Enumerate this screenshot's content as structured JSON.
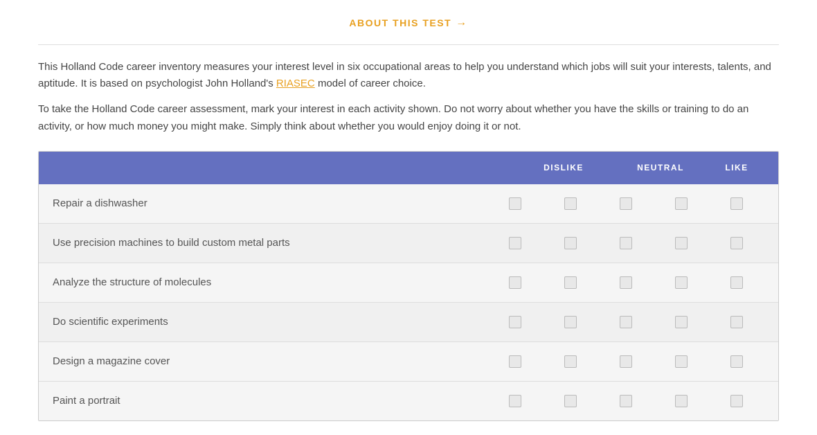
{
  "header": {
    "about_test_label": "ABOUT THIS TEST",
    "arrow": "→"
  },
  "intro": {
    "paragraph1": "This Holland Code career inventory measures your interest level in six occupational areas to help you understand which jobs will suit your interests, talents, and aptitude. It is based on psychologist John Holland's ",
    "riasec_label": "RIASEC",
    "paragraph1_end": " model of career choice.",
    "paragraph2": "To take the Holland Code career assessment, mark your interest in each activity shown. Do not worry about whether you have the skills or training to do an activity, or how much money you might make. Simply think about whether you would enjoy doing it or not."
  },
  "table": {
    "columns": {
      "dislike": "DISLIKE",
      "neutral": "NEUTRAL",
      "like": "LIKE"
    },
    "rows": [
      {
        "id": 1,
        "activity": "Repair a dishwasher"
      },
      {
        "id": 2,
        "activity": "Use precision machines to build custom metal parts"
      },
      {
        "id": 3,
        "activity": "Analyze the structure of molecules"
      },
      {
        "id": 4,
        "activity": "Do scientific experiments"
      },
      {
        "id": 5,
        "activity": "Design a magazine cover"
      },
      {
        "id": 6,
        "activity": "Paint a portrait"
      }
    ]
  }
}
